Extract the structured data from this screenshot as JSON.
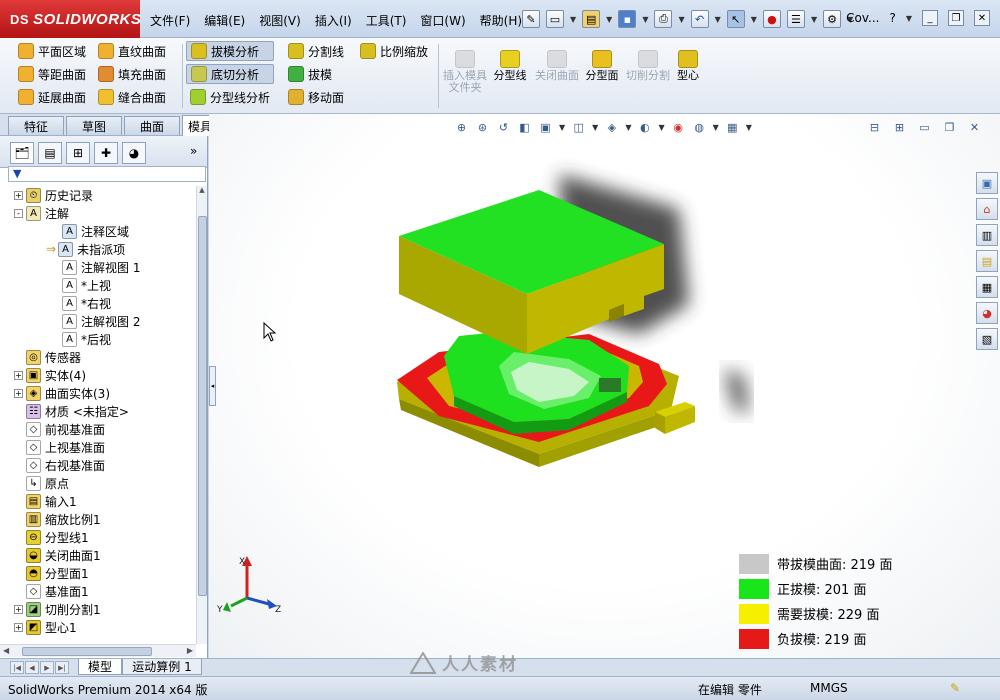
{
  "app": {
    "logo": "SOLIDWORKS",
    "logo_ds": "DS"
  },
  "menu": [
    "文件(F)",
    "编辑(E)",
    "视图(V)",
    "插入(I)",
    "工具(T)",
    "窗口(W)",
    "帮助(H)"
  ],
  "title_doc": "Cov...",
  "ribbon": {
    "col1": [
      "平面区域",
      "等距曲面",
      "延展曲面"
    ],
    "col2": [
      "直纹曲面",
      "填充曲面",
      "缝合曲面"
    ],
    "col3": [
      "拔模分析",
      "底切分析",
      "分型线分析"
    ],
    "col4": [
      "分割线",
      "拔模",
      "移动面"
    ],
    "col5": [
      "比例缩放"
    ],
    "big": [
      {
        "label": "插入模具文件夹",
        "enabled": false
      },
      {
        "label": "分型线",
        "enabled": true
      },
      {
        "label": "关闭曲面",
        "enabled": false
      },
      {
        "label": "分型面",
        "enabled": true
      },
      {
        "label": "切削分割",
        "enabled": false
      },
      {
        "label": "型心",
        "enabled": true
      }
    ]
  },
  "cm_tabs": [
    "特征",
    "草图",
    "曲面",
    "模具工具"
  ],
  "cm_active": "模具工具",
  "tree": [
    {
      "label": "历史记录",
      "level": 0,
      "expander": "+",
      "icon": "history-icon"
    },
    {
      "label": "注解",
      "level": 0,
      "expander": "-",
      "icon": "annotation-icon"
    },
    {
      "label": "注释区域",
      "level": 2,
      "expander": "",
      "icon": "notes-area-icon"
    },
    {
      "label": "未指派项",
      "level": 2,
      "expander": "",
      "icon": "unassigned-icon",
      "arrow": true
    },
    {
      "label": "注解视图 1",
      "level": 2,
      "expander": "",
      "icon": "annotation-view-icon"
    },
    {
      "label": "*上视",
      "level": 2,
      "expander": "",
      "icon": "annotation-view-icon"
    },
    {
      "label": "*右视",
      "level": 2,
      "expander": "",
      "icon": "annotation-view-icon"
    },
    {
      "label": "注解视图 2",
      "level": 2,
      "expander": "",
      "icon": "annotation-view-icon"
    },
    {
      "label": "*后视",
      "level": 2,
      "expander": "",
      "icon": "annotation-view-icon"
    },
    {
      "label": "传感器",
      "level": 1,
      "expander": "",
      "icon": "sensor-icon"
    },
    {
      "label": "实体(4)",
      "level": 0,
      "expander": "+",
      "icon": "solid-body-icon"
    },
    {
      "label": "曲面实体(3)",
      "level": 0,
      "expander": "+",
      "icon": "surface-body-icon"
    },
    {
      "label": "材质 <未指定>",
      "level": 1,
      "expander": "",
      "icon": "material-icon"
    },
    {
      "label": "前视基准面",
      "level": 1,
      "expander": "",
      "icon": "plane-icon"
    },
    {
      "label": "上视基准面",
      "level": 1,
      "expander": "",
      "icon": "plane-icon"
    },
    {
      "label": "右视基准面",
      "level": 1,
      "expander": "",
      "icon": "plane-icon"
    },
    {
      "label": "原点",
      "level": 1,
      "expander": "",
      "icon": "origin-icon"
    },
    {
      "label": "输入1",
      "level": 1,
      "expander": "",
      "icon": "import-icon"
    },
    {
      "label": "缩放比例1",
      "level": 1,
      "expander": "",
      "icon": "scale-icon"
    },
    {
      "label": "分型线1",
      "level": 1,
      "expander": "",
      "icon": "parting-line-icon"
    },
    {
      "label": "关闭曲面1",
      "level": 1,
      "expander": "",
      "icon": "shut-off-surface-icon"
    },
    {
      "label": "分型面1",
      "level": 1,
      "expander": "",
      "icon": "parting-surface-icon"
    },
    {
      "label": "基准面1",
      "level": 1,
      "expander": "",
      "icon": "plane-icon"
    },
    {
      "label": "切削分割1",
      "level": 0,
      "expander": "+",
      "icon": "tooling-split-icon"
    },
    {
      "label": "型心1",
      "level": 0,
      "expander": "+",
      "icon": "core-icon"
    }
  ],
  "legend": [
    {
      "label": "带拔模曲面: 219 面",
      "color": "#c8c8c8"
    },
    {
      "label": "正拔模: 201 面",
      "color": "#19e619"
    },
    {
      "label": "需要拔模: 229 面",
      "color": "#f5f000"
    },
    {
      "label": "负拔模: 219 面",
      "color": "#e61919"
    }
  ],
  "triad": {
    "x": "X",
    "y": "Y",
    "z": "Z"
  },
  "bottom_tabs": [
    "模型",
    "运动算例 1"
  ],
  "status": {
    "product": "SolidWorks Premium 2014 x64 版",
    "mode": "在编辑 零件",
    "units": "MMGS"
  },
  "watermark": "人人素材",
  "colors": {
    "green": "#22e022",
    "olive": "#a8a800",
    "red": "#e01a1a"
  }
}
